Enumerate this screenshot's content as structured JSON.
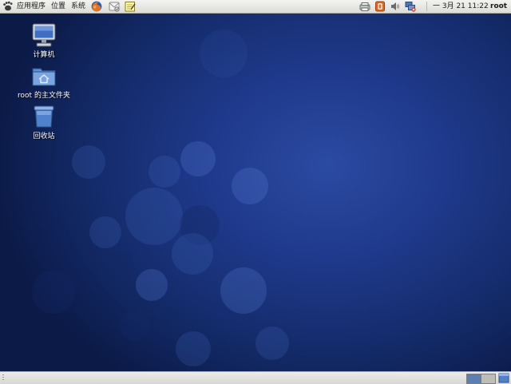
{
  "top_panel": {
    "menus": [
      {
        "label": "应用程序",
        "icon": "gnome-foot-icon"
      },
      {
        "label": "位置"
      },
      {
        "label": "系统"
      }
    ],
    "launchers": [
      "firefox-icon",
      "mail-client-icon",
      "notes-editor-icon"
    ],
    "tray": [
      "network-printer-icon",
      "update-notifier-icon",
      "volume-icon",
      "network-status-icon"
    ],
    "clock": "一 3月 21 11:22",
    "user": "root"
  },
  "desktop": {
    "icons": [
      {
        "label": "计算机",
        "icon": "computer-icon"
      },
      {
        "label": "root 的主文件夹",
        "icon": "home-folder-icon"
      },
      {
        "label": "回收站",
        "icon": "trash-icon"
      }
    ]
  },
  "bottom_panel": {
    "workspaces": [
      {
        "name": "workspace-1",
        "active": true
      },
      {
        "name": "workspace-2",
        "active": false
      }
    ],
    "trailing_icon": "show-desktop-icon"
  },
  "colors": {
    "desktop_bg": "#1f3a8c",
    "panel_bg": "#e6e6e3",
    "active_workspace": "#5a7fb7"
  }
}
